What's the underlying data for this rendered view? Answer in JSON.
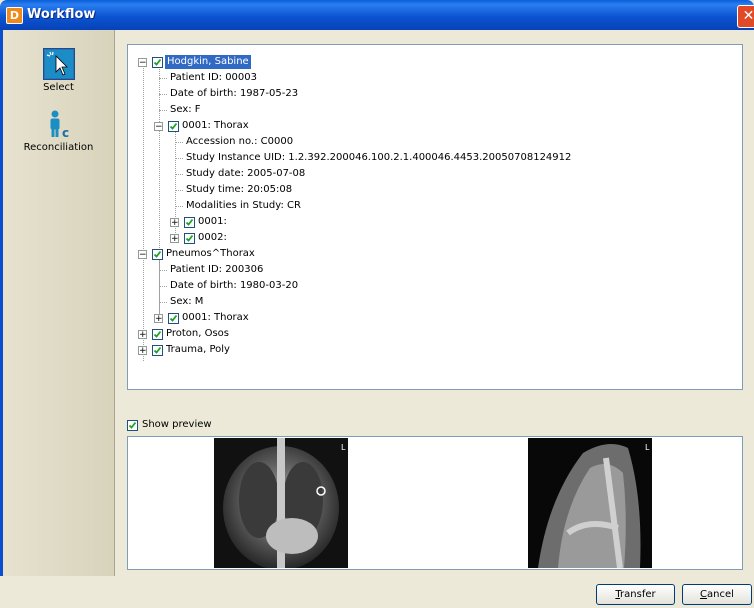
{
  "window": {
    "title": "Workflow",
    "app_icon_letter": "D",
    "close_glyph": "✕"
  },
  "sidebar": {
    "items": [
      {
        "label": "Select",
        "icon": "cursor-select-icon",
        "selected": true
      },
      {
        "label": "Reconciliation",
        "icon": "person-reconcile-icon",
        "selected": false
      }
    ]
  },
  "tree": {
    "rows": [
      {
        "text": "Hodgkin, Sabine",
        "checked": true,
        "expanded": true,
        "selected": true
      },
      {
        "text": "Patient ID: 00003"
      },
      {
        "text": "Date of birth: 1987-05-23"
      },
      {
        "text": "Sex: F"
      },
      {
        "text": "0001: Thorax",
        "checked": true,
        "expanded": true
      },
      {
        "text": "Accession no.: C0000"
      },
      {
        "text": "Study Instance UID: 1.2.392.200046.100.2.1.400046.4453.20050708124912"
      },
      {
        "text": "Study date: 2005-07-08"
      },
      {
        "text": "Study time: 20:05:08"
      },
      {
        "text": "Modalities in Study: CR"
      },
      {
        "text": "0001:",
        "checked": true,
        "expanded": false
      },
      {
        "text": "0002:",
        "checked": true,
        "expanded": false
      },
      {
        "text": "Pneumos^Thorax",
        "checked": true,
        "expanded": true
      },
      {
        "text": "Patient ID: 200306"
      },
      {
        "text": "Date of birth: 1980-03-20"
      },
      {
        "text": "Sex: M"
      },
      {
        "text": "0001: Thorax",
        "checked": true,
        "expanded": false
      },
      {
        "text": "Proton, Osos",
        "checked": true,
        "expanded": false
      },
      {
        "text": "Trauma, Poly",
        "checked": true,
        "expanded": false
      }
    ]
  },
  "preview": {
    "show_preview_label": "Show preview",
    "show_preview_checked": true,
    "images": [
      {
        "kind": "chest-xray-frontal",
        "marker": "L"
      },
      {
        "kind": "chest-xray-lateral",
        "marker": "L"
      }
    ]
  },
  "buttons": {
    "transfer": {
      "mnemonic": "T",
      "rest": "ransfer"
    },
    "cancel": {
      "mnemonic": "C",
      "rest": "ancel"
    }
  },
  "colors": {
    "titlebar": "#0a5fd8",
    "selection": "#316ac5",
    "check": "#21a121"
  }
}
